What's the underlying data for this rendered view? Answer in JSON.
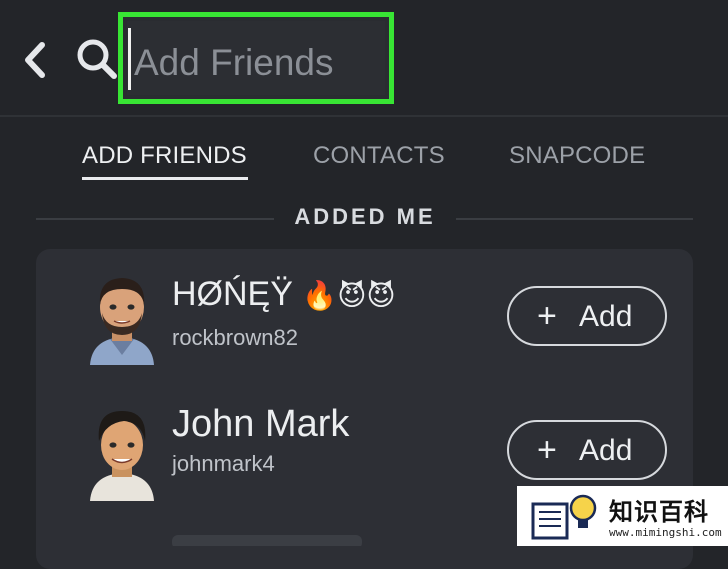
{
  "search": {
    "placeholder": "Add Friends",
    "value": ""
  },
  "tabs": [
    {
      "label": "ADD FRIENDS",
      "active": true
    },
    {
      "label": "CONTACTS",
      "active": false
    },
    {
      "label": "SNAPCODE",
      "active": false
    }
  ],
  "section": {
    "title": "ADDED ME"
  },
  "friends": [
    {
      "display_name": "HØŃĘŸ",
      "emoji": "🔥😈😈",
      "username": "rockbrown82",
      "action": "Add"
    },
    {
      "display_name": "John Mark",
      "username": "johnmark4",
      "action": "Add"
    }
  ],
  "watermark": {
    "title": "知识百科",
    "url": "www.mimingshi.com"
  },
  "colors": {
    "highlight": "#38e534",
    "background": "#232529",
    "card": "#2d2f35"
  }
}
